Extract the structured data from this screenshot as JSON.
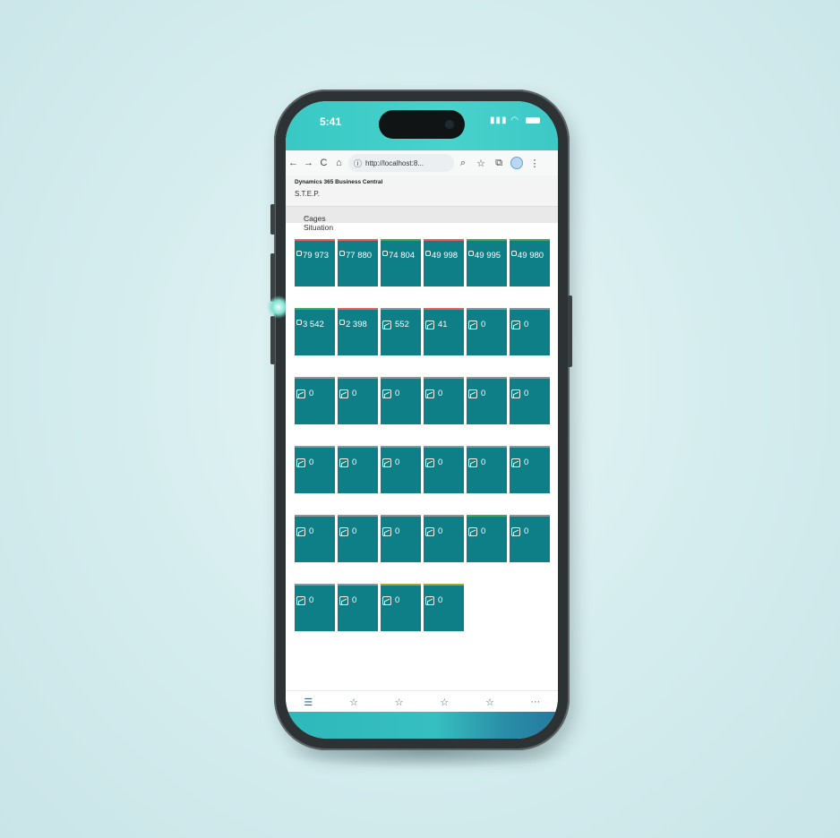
{
  "status_bar": {
    "time": "5:41"
  },
  "browser": {
    "back_icon": "←",
    "forward_icon": "→",
    "reload_icon": "C",
    "home_icon": "⌂",
    "info_icon": "ⓘ",
    "url": "http://localhost:8...",
    "zoom_icon": "🔍",
    "star_icon": "☆",
    "extensions_icon": "⧉",
    "menu_icon": "⋮"
  },
  "app": {
    "product": "Dynamics 365 Business Central",
    "company": "S.T.E.P.",
    "page_title": "Cages Situation",
    "page_title_chevron": "⌵"
  },
  "tiles": [
    {
      "value": "79 973",
      "indicator": "red",
      "icon": "small"
    },
    {
      "value": "77 880",
      "indicator": "red",
      "icon": "small"
    },
    {
      "value": "74 804",
      "indicator": "green",
      "icon": "small"
    },
    {
      "value": "49 998",
      "indicator": "red",
      "icon": "small"
    },
    {
      "value": "49 995",
      "indicator": "green",
      "icon": "small"
    },
    {
      "value": "49 980",
      "indicator": "green",
      "icon": "small"
    },
    {
      "value": "3 542",
      "indicator": "green",
      "icon": "small"
    },
    {
      "value": "2 398",
      "indicator": "red",
      "icon": "small"
    },
    {
      "value": "552",
      "indicator": "gray",
      "icon": "chart"
    },
    {
      "value": "41",
      "indicator": "red",
      "icon": "chart"
    },
    {
      "value": "0",
      "indicator": "gray",
      "icon": "chart"
    },
    {
      "value": "0",
      "indicator": "gray",
      "icon": "chart"
    },
    {
      "value": "0",
      "indicator": "gray",
      "icon": "chart"
    },
    {
      "value": "0",
      "indicator": "gray",
      "icon": "chart"
    },
    {
      "value": "0",
      "indicator": "gray",
      "icon": "chart"
    },
    {
      "value": "0",
      "indicator": "gray",
      "icon": "chart"
    },
    {
      "value": "0",
      "indicator": "gray",
      "icon": "chart"
    },
    {
      "value": "0",
      "indicator": "gray",
      "icon": "chart"
    },
    {
      "value": "0",
      "indicator": "gray",
      "icon": "chart"
    },
    {
      "value": "0",
      "indicator": "gray",
      "icon": "chart"
    },
    {
      "value": "0",
      "indicator": "gray",
      "icon": "chart"
    },
    {
      "value": "0",
      "indicator": "gray",
      "icon": "chart"
    },
    {
      "value": "0",
      "indicator": "gray",
      "icon": "chart"
    },
    {
      "value": "0",
      "indicator": "gray",
      "icon": "chart"
    },
    {
      "value": "0",
      "indicator": "gray",
      "icon": "chart"
    },
    {
      "value": "0",
      "indicator": "gray",
      "icon": "chart"
    },
    {
      "value": "0",
      "indicator": "gray",
      "icon": "chart"
    },
    {
      "value": "0",
      "indicator": "gray",
      "icon": "chart"
    },
    {
      "value": "0",
      "indicator": "green",
      "icon": "chart"
    },
    {
      "value": "0",
      "indicator": "gray",
      "icon": "chart"
    },
    {
      "value": "0",
      "indicator": "gray",
      "icon": "chart"
    },
    {
      "value": "0",
      "indicator": "gray",
      "icon": "chart"
    },
    {
      "value": "0",
      "indicator": "olive",
      "icon": "chart"
    },
    {
      "value": "0",
      "indicator": "olive",
      "icon": "chart"
    }
  ],
  "bottom_nav": [
    {
      "icon": "hamburger-icon",
      "glyph": "☰"
    },
    {
      "icon": "star-icon",
      "glyph": "☆"
    },
    {
      "icon": "star-icon",
      "glyph": "☆"
    },
    {
      "icon": "star-icon",
      "glyph": "☆"
    },
    {
      "icon": "star-icon",
      "glyph": "☆"
    },
    {
      "icon": "more-icon",
      "glyph": "···"
    }
  ],
  "colors": {
    "tile": "#0e7e87",
    "indicator_red": "#e16462",
    "indicator_green": "#3fa86a",
    "indicator_gray": "#8d969b",
    "indicator_olive": "#a4a637",
    "status_bar": "#48d2cc"
  }
}
